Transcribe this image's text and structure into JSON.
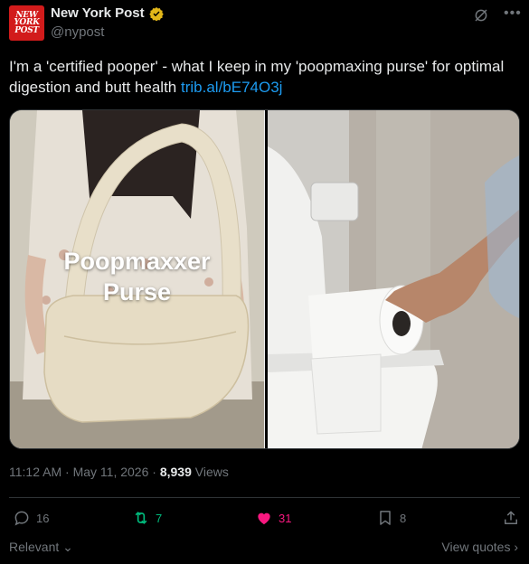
{
  "author": {
    "name": "New York Post",
    "handle": "@nypost",
    "avatar_text": "NEW YORK POST"
  },
  "tweet": {
    "text": "I'm a 'certified pooper' - what I keep in my 'poopmaxing purse' for optimal digestion and butt health",
    "link": "trib.al/bE74O3j"
  },
  "media": {
    "overlay_text_line1": "Poopmaxxer",
    "overlay_text_line2": "Purse"
  },
  "meta": {
    "time": "11:12 AM",
    "date": "May 11, 2026",
    "views_count": "8,939",
    "views_label": "Views"
  },
  "actions": {
    "replies": "16",
    "reposts": "7",
    "likes": "31",
    "bookmarks": "8"
  },
  "footer": {
    "relevant_label": "Relevant",
    "view_quotes_label": "View quotes"
  },
  "colors": {
    "background": "#000000",
    "text": "#e7e9ea",
    "muted": "#71767b",
    "link": "#1d9bf0",
    "repost_active": "#00ba7c",
    "like_active": "#f91880",
    "verified_gold": "#e2b719",
    "avatar_red": "#d21b1b"
  }
}
